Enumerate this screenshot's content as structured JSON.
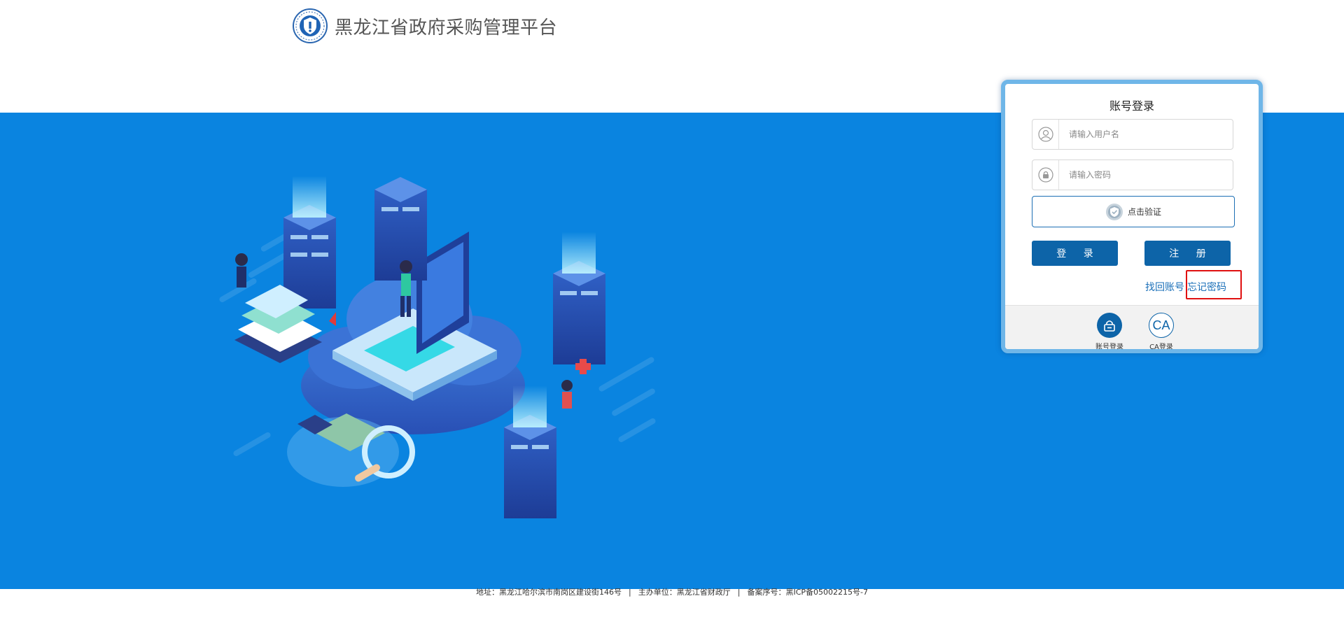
{
  "header": {
    "site_title": "黑龙江省政府采购管理平台"
  },
  "login": {
    "title": "账号登录",
    "username_placeholder": "请输入用户名",
    "password_placeholder": "请输入密码",
    "verify_label": "点击验证",
    "login_button": "登 录",
    "register_button": "注 册",
    "find_account_link": "找回账号",
    "forgot_password_link": "忘记密码",
    "tabs": [
      {
        "label": "账号登录",
        "icon": "lock-icon"
      },
      {
        "label": "CA登录",
        "icon": "ca-icon",
        "icon_text": "CA"
      }
    ]
  },
  "footer": {
    "address": "地址：黑龙江哈尔滨市南岗区建设街146号",
    "host": "主办单位：黑龙江省财政厅",
    "icp": "备案序号：黑ICP备05002215号-7",
    "separator": "|"
  },
  "colors": {
    "banner_blue": "#0a84e0",
    "button_blue": "#0d64a8",
    "link_blue": "#1a6fb8",
    "highlight_red": "#e01010"
  }
}
